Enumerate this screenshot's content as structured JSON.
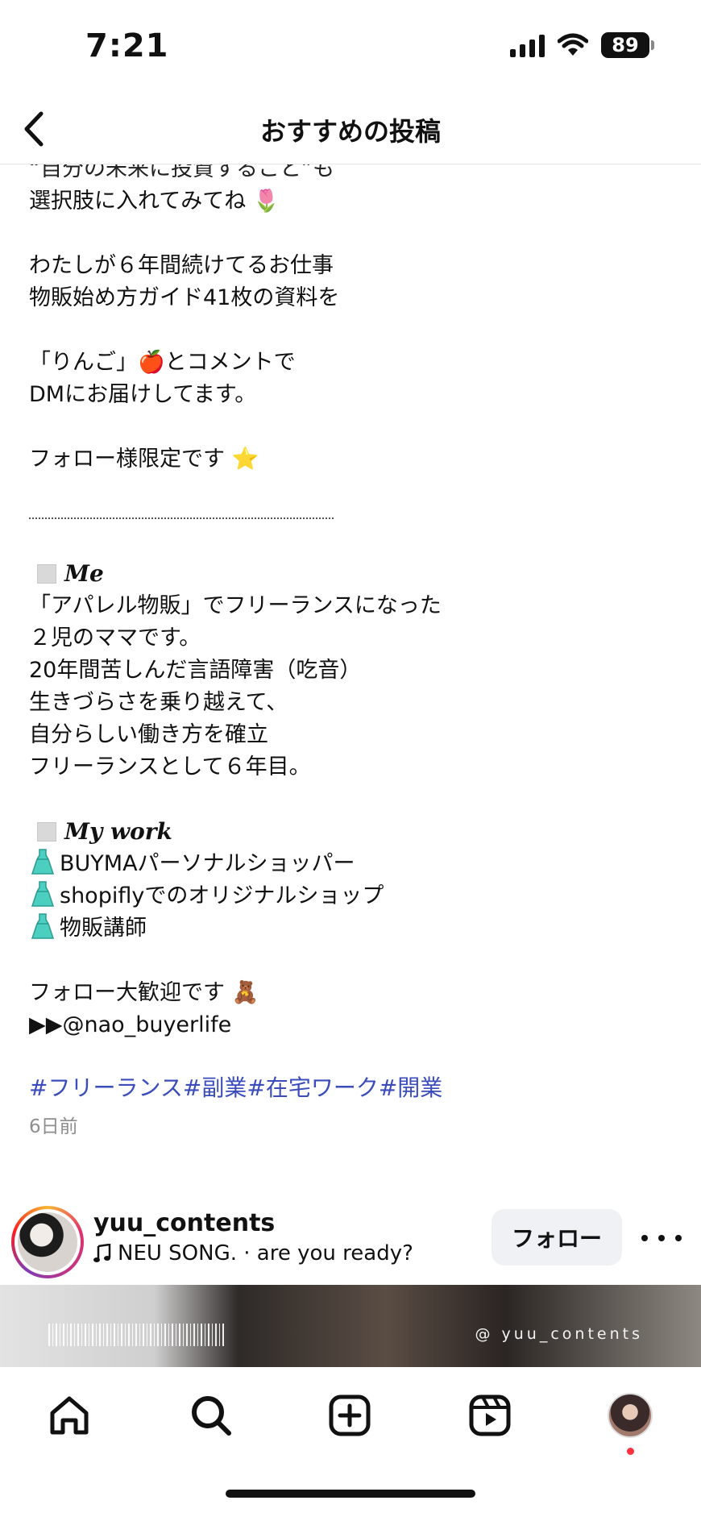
{
  "status_bar": {
    "time": "7:21",
    "battery": "89",
    "icons": [
      "signal-icon",
      "wifi-icon",
      "battery-icon"
    ]
  },
  "nav": {
    "back_icon": "chevron-left-icon",
    "title": "おすすめの投稿"
  },
  "caption": {
    "clipped_top_line": "“自分の未来に投資すること”も",
    "lines_block1": [
      "選択肢に入れてみてね 🌷"
    ],
    "lines_block2": [
      "わたしが６年間続けてるお仕事",
      "物販始め方ガイド41枚の資料を"
    ],
    "lines_block3": [
      "「りんご」🍎とコメントで",
      "DMにお届けしてます。"
    ],
    "lines_block4": [
      "フォロー様限定です ⭐"
    ],
    "me_heading": "Me",
    "me_lines": [
      "「アパレル物販」でフリーランスになった",
      "２児のママです。",
      "20年間苦しんだ言語障害（吃音）",
      "生きづらさを乗り越えて、",
      "自分らしい働き方を確立",
      "フリーランスとして６年目。"
    ],
    "work_heading": "My work",
    "work_items": [
      "BUYMAパーソナルショッパー",
      "shopiflyでのオリジナルショップ",
      "物販講師"
    ],
    "closing_lines": [
      "フォロー大歓迎です 🧸",
      "▶▶@nao_buyerlife"
    ],
    "hashtags": "#フリーランス#副業#在宅ワーク#開業",
    "timestamp": "6日前"
  },
  "next_post": {
    "username": "yuu_contents",
    "music_icon": "music-note-icon",
    "music_text": "NEU SONG. · are you ready?",
    "follow_label": "フォロー",
    "more_icon": "more-dots-icon",
    "watermark": "@ yuu_contents"
  },
  "tab_bar": {
    "items": [
      "home-icon",
      "search-icon",
      "create-icon",
      "reels-icon",
      "profile-avatar"
    ]
  }
}
